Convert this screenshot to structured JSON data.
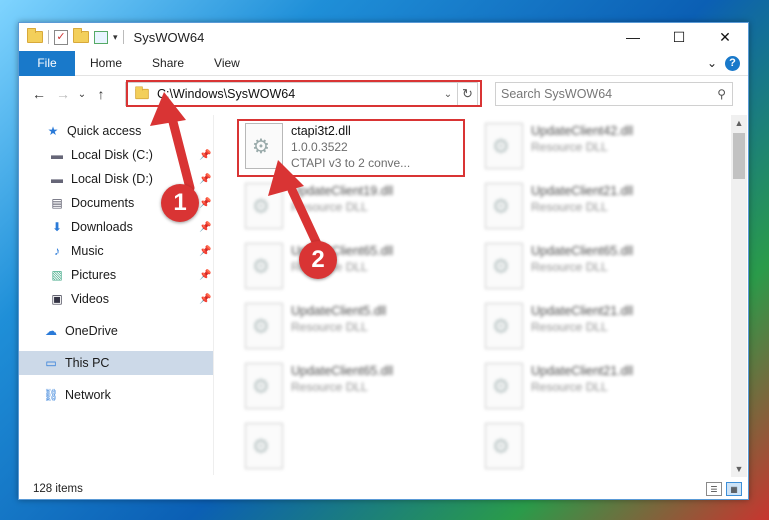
{
  "window": {
    "title": "SysWOW64",
    "controls": {
      "minimize": "—",
      "maximize": "☐",
      "close": "✕"
    }
  },
  "ribbon": {
    "file": "File",
    "tabs": [
      "Home",
      "Share",
      "View"
    ],
    "expand_icon": "⌄",
    "help": "?"
  },
  "navigation": {
    "back": "←",
    "forward": "→",
    "recent": "⌄",
    "up": "↑",
    "address": "C:\\Windows\\SysWOW64",
    "address_dropdown": "⌄",
    "refresh": "↻",
    "search_placeholder": "Search SysWOW64",
    "search_icon": "⚲"
  },
  "sidebar": {
    "items": [
      {
        "label": "Quick access",
        "icon": "star-icon",
        "glyph": "★"
      },
      {
        "label": "Local Disk (C:)",
        "icon": "drive-icon",
        "glyph": "▬",
        "pin": "📌"
      },
      {
        "label": "Local Disk (D:)",
        "icon": "drive-icon",
        "glyph": "▬",
        "pin": "📌"
      },
      {
        "label": "Documents",
        "icon": "documents-icon",
        "glyph": "▤",
        "pin": "📌"
      },
      {
        "label": "Downloads",
        "icon": "downloads-icon",
        "glyph": "⬇",
        "pin": "📌"
      },
      {
        "label": "Music",
        "icon": "music-icon",
        "glyph": "♪",
        "pin": "📌"
      },
      {
        "label": "Pictures",
        "icon": "pictures-icon",
        "glyph": "▧",
        "pin": "📌"
      },
      {
        "label": "Videos",
        "icon": "videos-icon",
        "glyph": "▣",
        "pin": "📌"
      },
      {
        "label": "OneDrive",
        "icon": "cloud-icon",
        "glyph": "☁"
      },
      {
        "label": "This PC",
        "icon": "computer-icon",
        "glyph": "▭"
      },
      {
        "label": "Network",
        "icon": "network-icon",
        "glyph": "⛓"
      }
    ]
  },
  "files": {
    "highlighted": {
      "name": "ctapi3t2.dll",
      "version": "1.0.0.3522",
      "description": "CTAPI v3 to 2 conve..."
    },
    "tiles": [
      {
        "name": "UpdateClient42.dll",
        "type": "Resource DLL"
      },
      {
        "name": "UpdateClient19.dll",
        "type": "Resource DLL"
      },
      {
        "name": "UpdateClient21.dll",
        "type": "Resource DLL"
      },
      {
        "name": "UpdateClient65.dll",
        "type": "Resource DLL"
      },
      {
        "name": "UpdateClient65.dll",
        "type": "Resource DLL"
      },
      {
        "name": "UpdateClient5.dll",
        "type": "Resource DLL"
      },
      {
        "name": "UpdateClient21.dll",
        "type": "Resource DLL"
      },
      {
        "name": "UpdateClient65.dll",
        "type": "Resource DLL"
      },
      {
        "name": "UpdateClient21.dll",
        "type": "Resource DLL"
      }
    ]
  },
  "status": {
    "count": "128 items",
    "view_details": "☰",
    "view_tiles": "▦"
  },
  "annotations": {
    "step1": "1",
    "step2": "2",
    "color": "#d93434"
  }
}
